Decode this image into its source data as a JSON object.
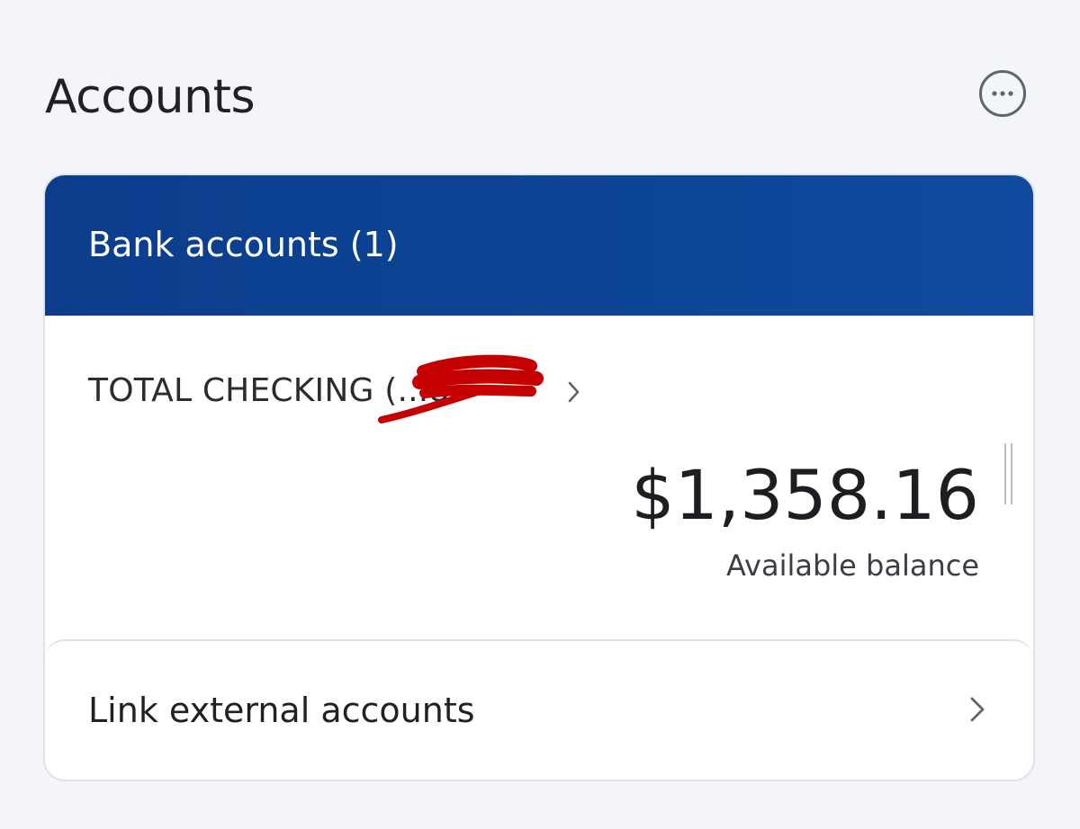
{
  "page": {
    "title": "Accounts",
    "more_icon": "more-horizontal-icon"
  },
  "bank_accounts": {
    "header": "Bank accounts (1)",
    "accounts": [
      {
        "name": "TOTAL CHECKING (...8",
        "balance": "$1,358.16",
        "balance_label": "Available balance",
        "chevron_icon": "chevron-right-icon"
      }
    ]
  },
  "link_external": {
    "label": "Link external accounts",
    "chevron_icon": "chevron-right-icon"
  },
  "colors": {
    "background": "#f4f5f9",
    "header_blue": "#0d4596",
    "redaction_red": "#c40000",
    "text_dark": "#1f2125"
  }
}
